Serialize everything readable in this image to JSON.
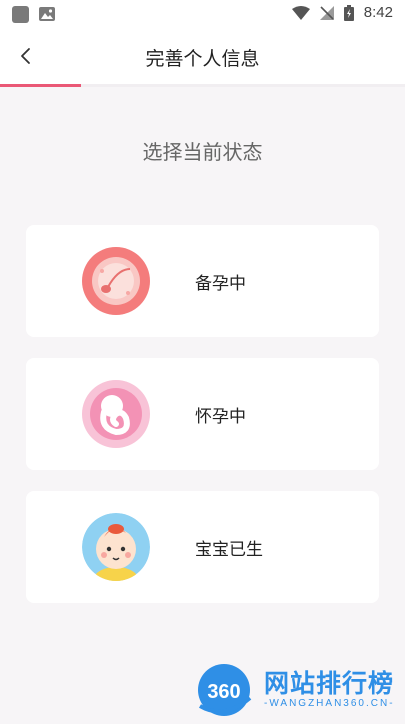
{
  "status_bar": {
    "time": "8:42"
  },
  "header": {
    "title": "完善个人信息"
  },
  "progress": {
    "fraction": 0.2,
    "accent": "#ea5876"
  },
  "prompt": "选择当前状态",
  "options": [
    {
      "label": "备孕中",
      "icon": "sperm-egg-icon"
    },
    {
      "label": "怀孕中",
      "icon": "fetus-icon"
    },
    {
      "label": "宝宝已生",
      "icon": "baby-icon"
    }
  ],
  "watermark": {
    "logo": "360",
    "text": "网站排行榜",
    "sub": "-WANGZHAN360.CN-"
  }
}
